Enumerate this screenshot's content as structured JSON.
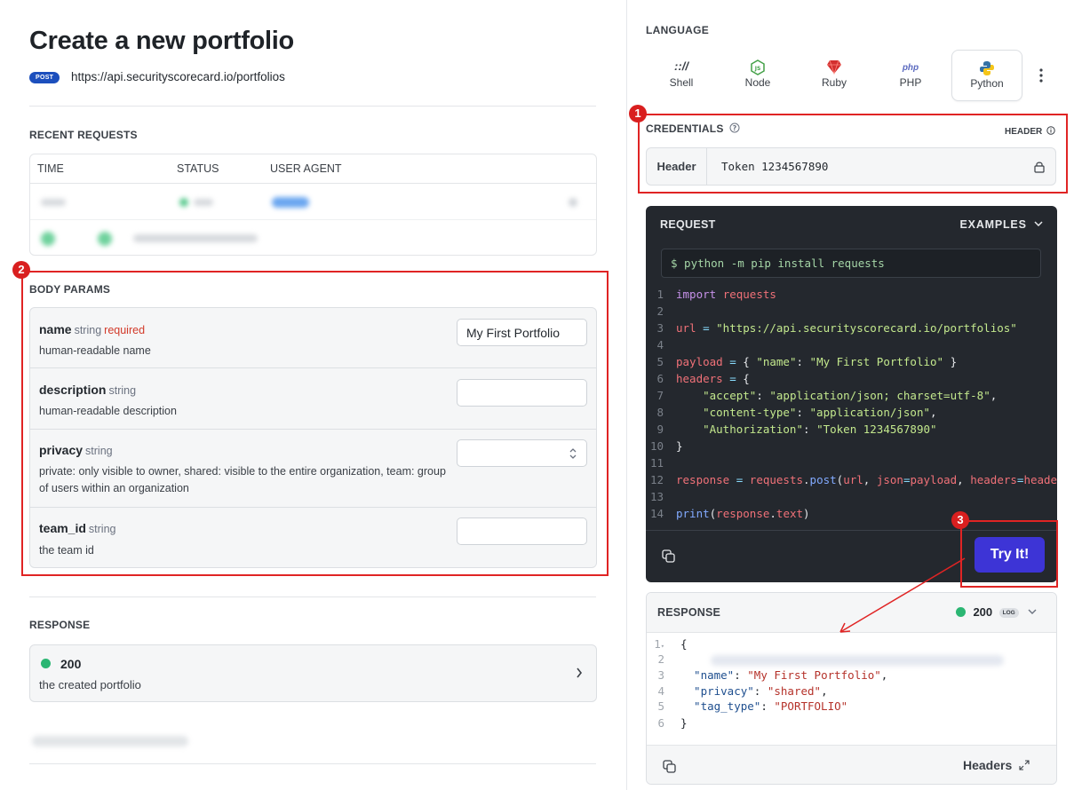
{
  "page": {
    "title": "Create a new portfolio",
    "method": "POST",
    "url": "https://api.securityscorecard.io/portfolios"
  },
  "recent_requests": {
    "title": "RECENT REQUESTS",
    "columns": [
      "TIME",
      "STATUS",
      "USER AGENT"
    ]
  },
  "body_params": {
    "title": "BODY PARAMS",
    "params": [
      {
        "name": "name",
        "type": "string",
        "required": "required",
        "description": "human-readable name",
        "value": "My First Portfolio"
      },
      {
        "name": "description",
        "type": "string",
        "required": "",
        "description": "human-readable description",
        "value": ""
      },
      {
        "name": "privacy",
        "type": "string",
        "required": "",
        "description": "private: only visible to owner, shared: visible to the entire organization, team: group of users within an organization",
        "value": ""
      },
      {
        "name": "team_id",
        "type": "string",
        "required": "",
        "description": "the team id",
        "value": ""
      }
    ]
  },
  "response_section": {
    "title": "RESPONSE",
    "status": "200",
    "description": "the created portfolio"
  },
  "language": {
    "label": "LANGUAGE",
    "options": [
      "Shell",
      "Node",
      "Ruby",
      "PHP",
      "Python"
    ],
    "selected": "Python"
  },
  "credentials": {
    "title": "CREDENTIALS",
    "header_label": "HEADER",
    "field_label": "Header",
    "value": "Token 1234567890"
  },
  "request": {
    "title": "REQUEST",
    "examples_label": "EXAMPLES",
    "install_cmd": "$ python -m pip install requests",
    "try_label": "Try It!",
    "code_lines": [
      "import requests",
      "",
      "url = \"https://api.securityscorecard.io/portfolios\"",
      "",
      "payload = { \"name\": \"My First Portfolio\" }",
      "headers = {",
      "    \"accept\": \"application/json; charset=utf-8\",",
      "    \"content-type\": \"application/json\",",
      "    \"Authorization\": \"Token 1234567890\"",
      "}",
      "",
      "response = requests.post(url, json=payload, headers=headers)",
      "",
      "print(response.text)"
    ]
  },
  "response_panel": {
    "title": "RESPONSE",
    "status": "200",
    "log_badge": "LOG",
    "lines": [
      "{",
      "",
      "\"name\": \"My First Portfolio\",",
      "\"privacy\": \"shared\",",
      "\"tag_type\": \"PORTFOLIO\"",
      "}"
    ],
    "headers_label": "Headers"
  },
  "annotations": [
    "1",
    "2",
    "3"
  ],
  "colors": {
    "accent": "#3d34d6",
    "highlight": "#e02424",
    "success": "#2bb673",
    "post": "#1c4fbd"
  }
}
